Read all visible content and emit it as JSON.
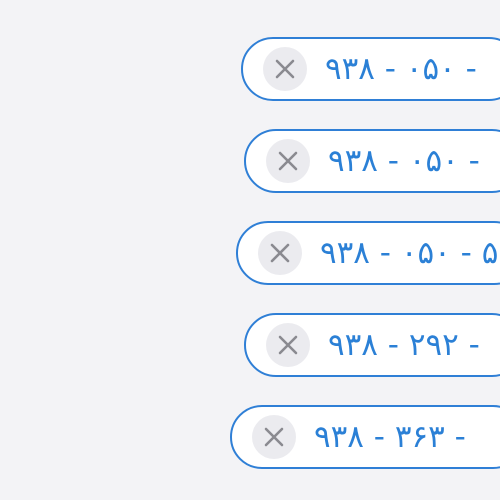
{
  "colors": {
    "background": "#f3f3f6",
    "chip_border": "#2f7fd6",
    "chip_text": "#2b80d6",
    "close_bg": "#ebebef",
    "close_icon": "#8a8a90"
  },
  "chips": [
    {
      "label": "۹۳۸ - ۰۵۰ - ",
      "icon": "close-icon"
    },
    {
      "label": "۹۳۸ - ۰۵۰ - ",
      "icon": "close-icon"
    },
    {
      "label": "۹۳۸ - ۰۵۰ - ۵",
      "icon": "close-icon"
    },
    {
      "label": "۹۳۸ - ۲۹۲ - ",
      "icon": "close-icon"
    },
    {
      "label": "۹۳۸ - ۳۶۳ - ",
      "icon": "close-icon"
    }
  ]
}
